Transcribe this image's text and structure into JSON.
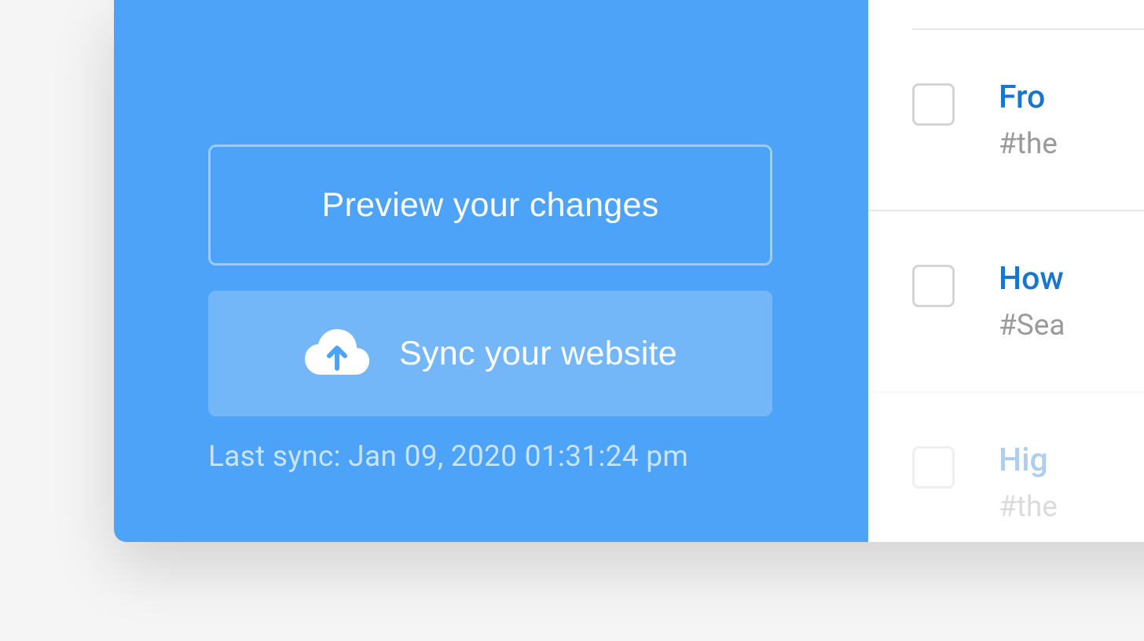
{
  "panel": {
    "preview_label": "Preview your changes",
    "sync_label": "Sync your website",
    "last_sync_label": "Last sync: Jan 09, 2020 01:31:24 pm"
  },
  "list": {
    "items": [
      {
        "title": "Fro",
        "tag": "#the"
      },
      {
        "title": "How",
        "tag": "#Sea"
      },
      {
        "title": "Hig",
        "tag": "#the"
      }
    ]
  }
}
